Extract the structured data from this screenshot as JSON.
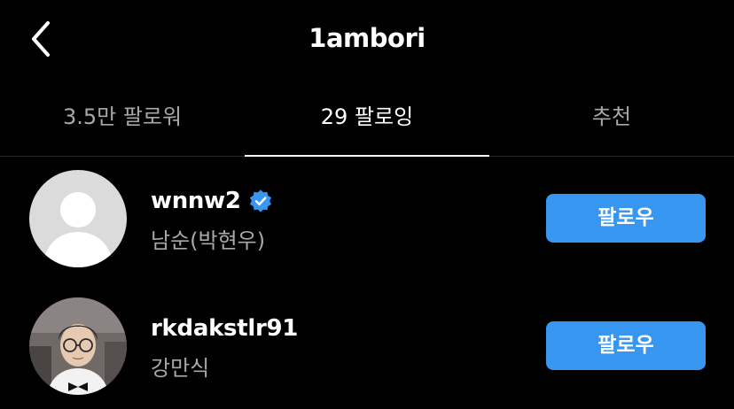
{
  "header": {
    "back_icon": "chevron-left-icon",
    "title": "1ambori"
  },
  "tabs": [
    {
      "label": "3.5만 팔로워",
      "active": false
    },
    {
      "label": "29 팔로잉",
      "active": true
    },
    {
      "label": "추천",
      "active": false
    }
  ],
  "users": [
    {
      "username": "wnnw2",
      "full_name": "남순(박현우)",
      "verified": true,
      "avatar": "default-avatar-icon",
      "follow_label": "팔로우"
    },
    {
      "username": "rkdakstlr91",
      "full_name": "강만식",
      "verified": false,
      "avatar": "profile-photo",
      "follow_label": "팔로우"
    }
  ],
  "colors": {
    "background": "#000000",
    "accent": "#3797f0",
    "secondary_text": "#a8a8a8",
    "verified": "#3797f0"
  }
}
